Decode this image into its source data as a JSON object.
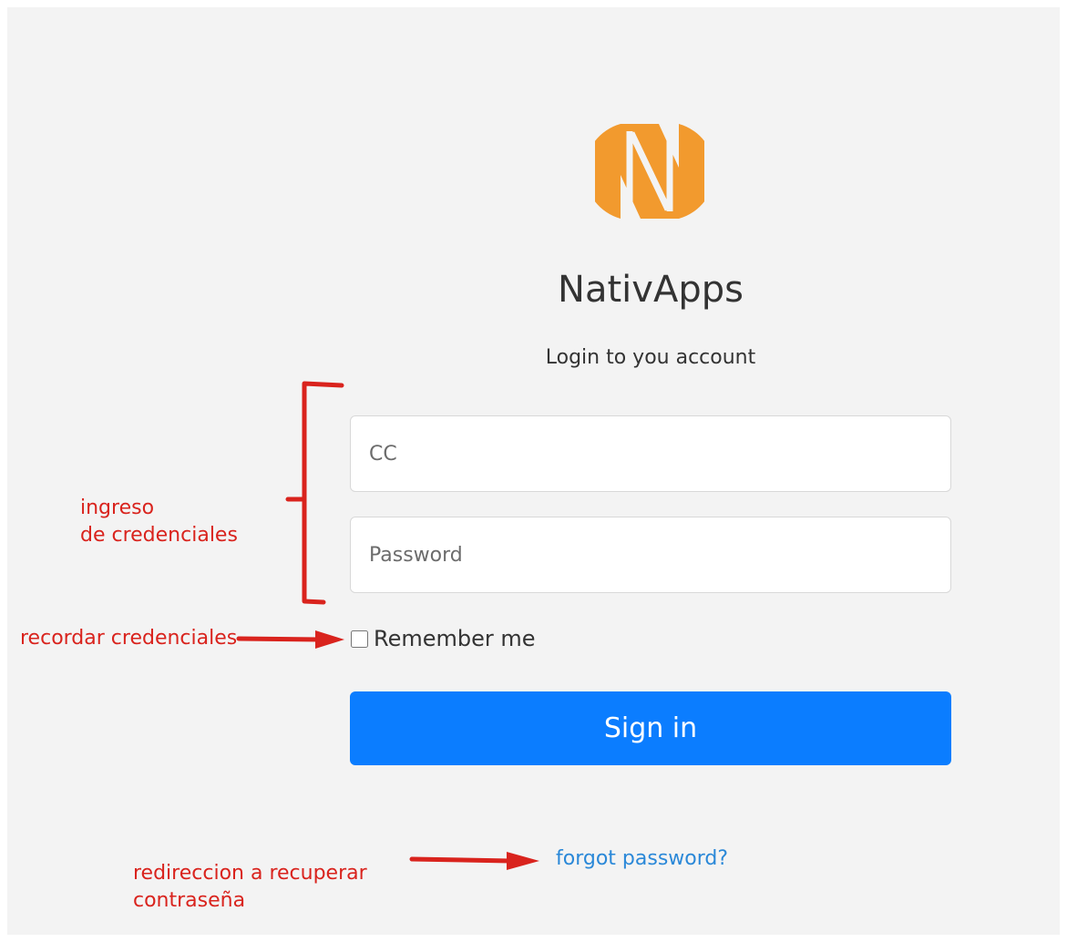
{
  "brand": {
    "name": "NativApps",
    "logo_icon": "nativapps-logo-icon",
    "logo_color": "#F29A2E"
  },
  "login": {
    "subtitle": "Login to you account",
    "cc_placeholder": "CC",
    "password_placeholder": "Password",
    "remember_label": "Remember me",
    "remember_checked": false,
    "signin_label": "Sign in",
    "forgot_link": "forgot password?"
  },
  "annotations": {
    "credentials_line1": "ingreso",
    "credentials_line2": "de credenciales",
    "remember": "recordar credenciales",
    "forgot_line1": "redireccion a recuperar",
    "forgot_line2": "contraseña",
    "color": "#D9231D"
  },
  "colors": {
    "primary": "#0B7DFF",
    "link": "#2A88D8",
    "background": "#F3F3F3"
  }
}
